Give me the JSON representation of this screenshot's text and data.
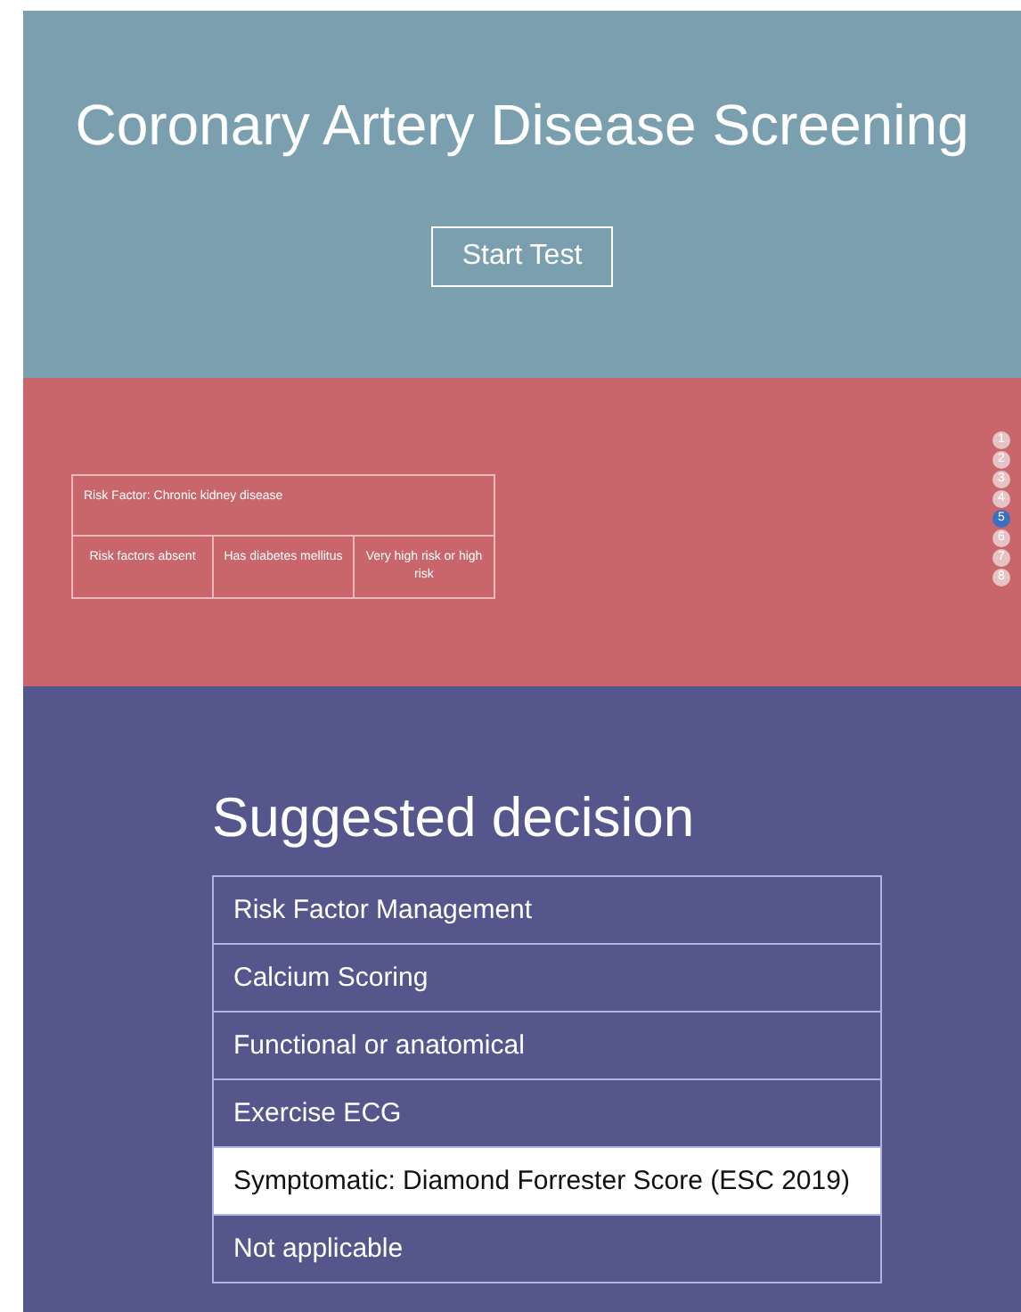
{
  "header": {
    "title": "Coronary Artery Disease Screening",
    "button": "Start Test"
  },
  "risk_table": {
    "title": "Risk Factor: Chronic kidney disease",
    "options": [
      "Risk factors absent",
      "Has diabetes mellitus",
      "Very high risk or high risk"
    ]
  },
  "pager": [
    {
      "label": "1",
      "selected": false
    },
    {
      "label": "2",
      "selected": false
    },
    {
      "label": "3",
      "selected": false
    },
    {
      "label": "4",
      "selected": false
    },
    {
      "label": "5",
      "selected": true
    },
    {
      "label": "6",
      "selected": false
    },
    {
      "label": "7",
      "selected": false
    },
    {
      "label": "8",
      "selected": false
    }
  ],
  "decision": {
    "title": "Suggested decision",
    "options": [
      {
        "label": "Risk Factor Management",
        "selected": false
      },
      {
        "label": "Calcium Scoring",
        "selected": false
      },
      {
        "label": "Functional or anatomical",
        "selected": false
      },
      {
        "label": "Exercise ECG",
        "selected": false
      },
      {
        "label": "Symptomatic: Diamond Forrester Score (ESC 2019)",
        "selected": true
      },
      {
        "label": "Not applicable",
        "selected": false
      }
    ]
  }
}
